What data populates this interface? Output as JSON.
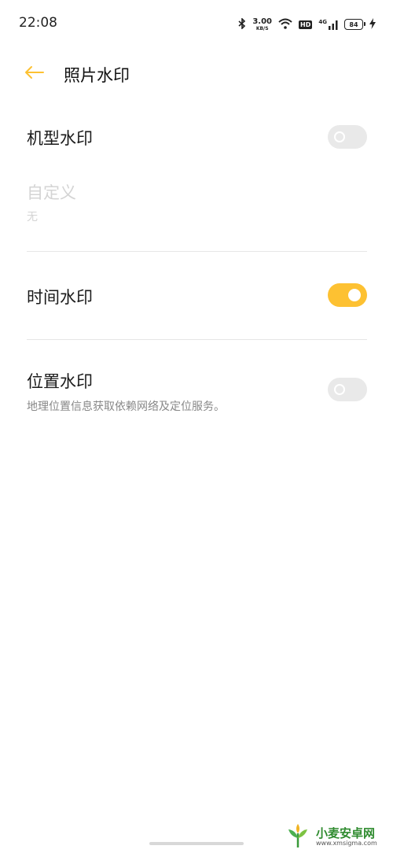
{
  "status_bar": {
    "time": "22:08",
    "net_speed_value": "3.00",
    "net_speed_unit": "KB/S",
    "hd": "HD",
    "network_type": "4G",
    "battery": "84"
  },
  "header": {
    "title": "照片水印"
  },
  "settings": {
    "model_watermark": {
      "label": "机型水印",
      "enabled": false
    },
    "custom": {
      "label": "自定义",
      "value": "无"
    },
    "time_watermark": {
      "label": "时间水印",
      "enabled": true
    },
    "location_watermark": {
      "label": "位置水印",
      "description": "地理位置信息获取依赖网络及定位服务。",
      "enabled": false
    }
  },
  "watermark_logo": {
    "name": "小麦安卓网",
    "url": "www.xmsigma.com"
  },
  "colors": {
    "accent": "#fdc132",
    "toggle_off": "#e9e9e9",
    "text_primary": "#1a1a1a",
    "text_secondary": "#888888",
    "text_disabled": "#d4d4d4"
  }
}
